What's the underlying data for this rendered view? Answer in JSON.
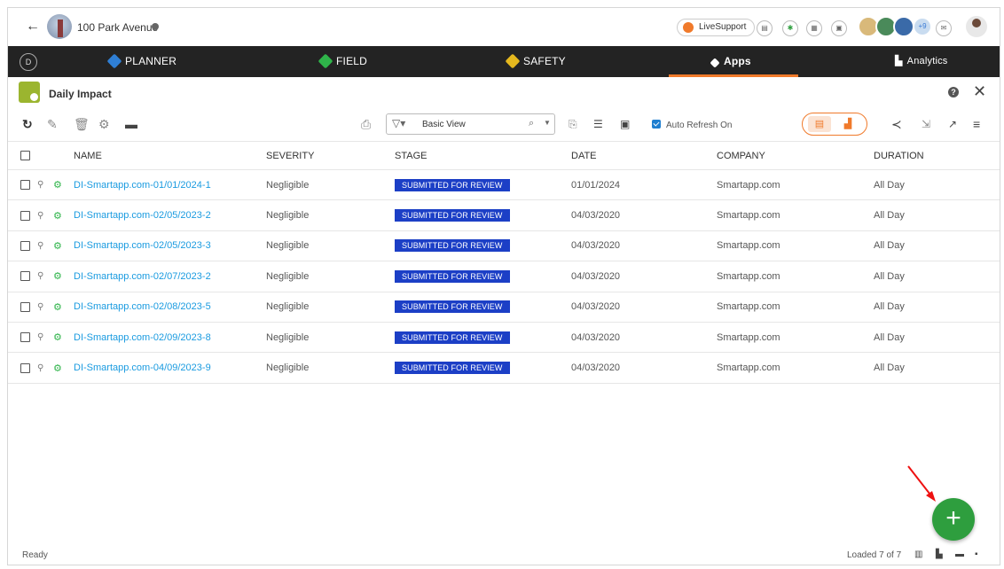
{
  "project": {
    "title": "100 Park Avenue"
  },
  "top": {
    "livesupport": "LiveSupport",
    "avatars_more": "+9"
  },
  "nav": {
    "planner": "PLANNER",
    "field": "FIELD",
    "safety": "SAFETY",
    "apps": "Apps",
    "analytics": "Analytics"
  },
  "app": {
    "title": "Daily Impact",
    "help": "?"
  },
  "toolbar": {
    "view": "Basic View",
    "auto_refresh": "Auto Refresh On"
  },
  "grid": {
    "headers": [
      "NAME",
      "SEVERITY",
      "STAGE",
      "DATE",
      "COMPANY",
      "DURATION"
    ],
    "rows": [
      {
        "name": "DI-Smartapp.com-01/01/2024-1",
        "severity": "Negligible",
        "stage": "SUBMITTED FOR REVIEW",
        "date": "01/01/2024",
        "company": "Smartapp.com",
        "duration": "All Day"
      },
      {
        "name": "DI-Smartapp.com-02/05/2023-2",
        "severity": "Negligible",
        "stage": "SUBMITTED FOR REVIEW",
        "date": "04/03/2020",
        "company": "Smartapp.com",
        "duration": "All Day"
      },
      {
        "name": "DI-Smartapp.com-02/05/2023-3",
        "severity": "Negligible",
        "stage": "SUBMITTED FOR REVIEW",
        "date": "04/03/2020",
        "company": "Smartapp.com",
        "duration": "All Day"
      },
      {
        "name": "DI-Smartapp.com-02/07/2023-2",
        "severity": "Negligible",
        "stage": "SUBMITTED FOR REVIEW",
        "date": "04/03/2020",
        "company": "Smartapp.com",
        "duration": "All Day"
      },
      {
        "name": "DI-Smartapp.com-02/08/2023-5",
        "severity": "Negligible",
        "stage": "SUBMITTED FOR REVIEW",
        "date": "04/03/2020",
        "company": "Smartapp.com",
        "duration": "All Day"
      },
      {
        "name": "DI-Smartapp.com-02/09/2023-8",
        "severity": "Negligible",
        "stage": "SUBMITTED FOR REVIEW",
        "date": "04/03/2020",
        "company": "Smartapp.com",
        "duration": "All Day"
      },
      {
        "name": "DI-Smartapp.com-04/09/2023-9",
        "severity": "Negligible",
        "stage": "SUBMITTED FOR REVIEW",
        "date": "04/03/2020",
        "company": "Smartapp.com",
        "duration": "All Day"
      }
    ]
  },
  "footer": {
    "status": "Ready",
    "loaded": "Loaded 7 of 7"
  },
  "colors": {
    "accent": "#f07a2b",
    "stage_badge": "#1c3fc6",
    "link": "#1a9be0",
    "fab": "#2e9e3e",
    "nav_bg": "#232323"
  },
  "icons": [
    "back-arrow-icon",
    "settings-icon",
    "refresh-icon",
    "edit-icon",
    "delete-icon",
    "filter-icon",
    "search-icon",
    "share-icon",
    "export-icon",
    "menu-icon",
    "add-icon",
    "close-icon",
    "help-icon"
  ]
}
